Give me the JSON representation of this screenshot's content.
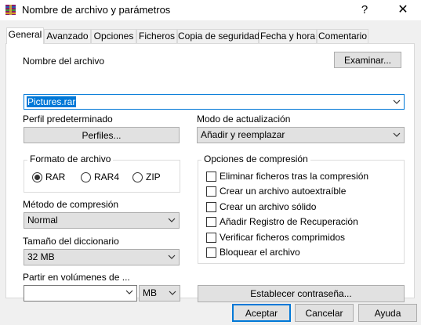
{
  "window": {
    "title": "Nombre de archivo y parámetros",
    "help": "?",
    "close": "✕"
  },
  "tabs": [
    {
      "label": "General",
      "active": true
    },
    {
      "label": "Avanzado"
    },
    {
      "label": "Opciones"
    },
    {
      "label": "Ficheros"
    },
    {
      "label": "Copia de seguridad"
    },
    {
      "label": "Fecha y hora"
    },
    {
      "label": "Comentario"
    }
  ],
  "general": {
    "filename_label": "Nombre del archivo",
    "browse_button": "Examinar...",
    "filename_value": "Pictures.rar",
    "profile_label": "Perfil predeterminado",
    "profiles_button": "Perfiles...",
    "update_mode_label": "Modo de actualización",
    "update_mode_value": "Añadir y reemplazar",
    "format_group": "Formato de archivo",
    "formats": [
      {
        "label": "RAR",
        "checked": true
      },
      {
        "label": "RAR4",
        "checked": false
      },
      {
        "label": "ZIP",
        "checked": false
      }
    ],
    "compression_method_label": "Método de compresión",
    "compression_method_value": "Normal",
    "dictionary_label": "Tamaño del diccionario",
    "dictionary_value": "32 MB",
    "split_label": "Partir en volúmenes de ...",
    "split_value": "",
    "split_unit": "MB",
    "options_group": "Opciones de compresión",
    "options": [
      {
        "label": "Eliminar ficheros tras la compresión",
        "checked": false
      },
      {
        "label": "Crear un archivo autoextraíble",
        "checked": false
      },
      {
        "label": "Crear un archivo sólido",
        "checked": false
      },
      {
        "label": "Añadir Registro de Recuperación",
        "checked": false
      },
      {
        "label": "Verificar ficheros comprimidos",
        "checked": false
      },
      {
        "label": "Bloquear el archivo",
        "checked": false
      }
    ],
    "password_button": "Establecer contraseña..."
  },
  "footer": {
    "ok": "Aceptar",
    "cancel": "Cancelar",
    "help": "Ayuda"
  },
  "colors": {
    "accent": "#0078d7",
    "panel_bg": "#f0f0f0"
  }
}
